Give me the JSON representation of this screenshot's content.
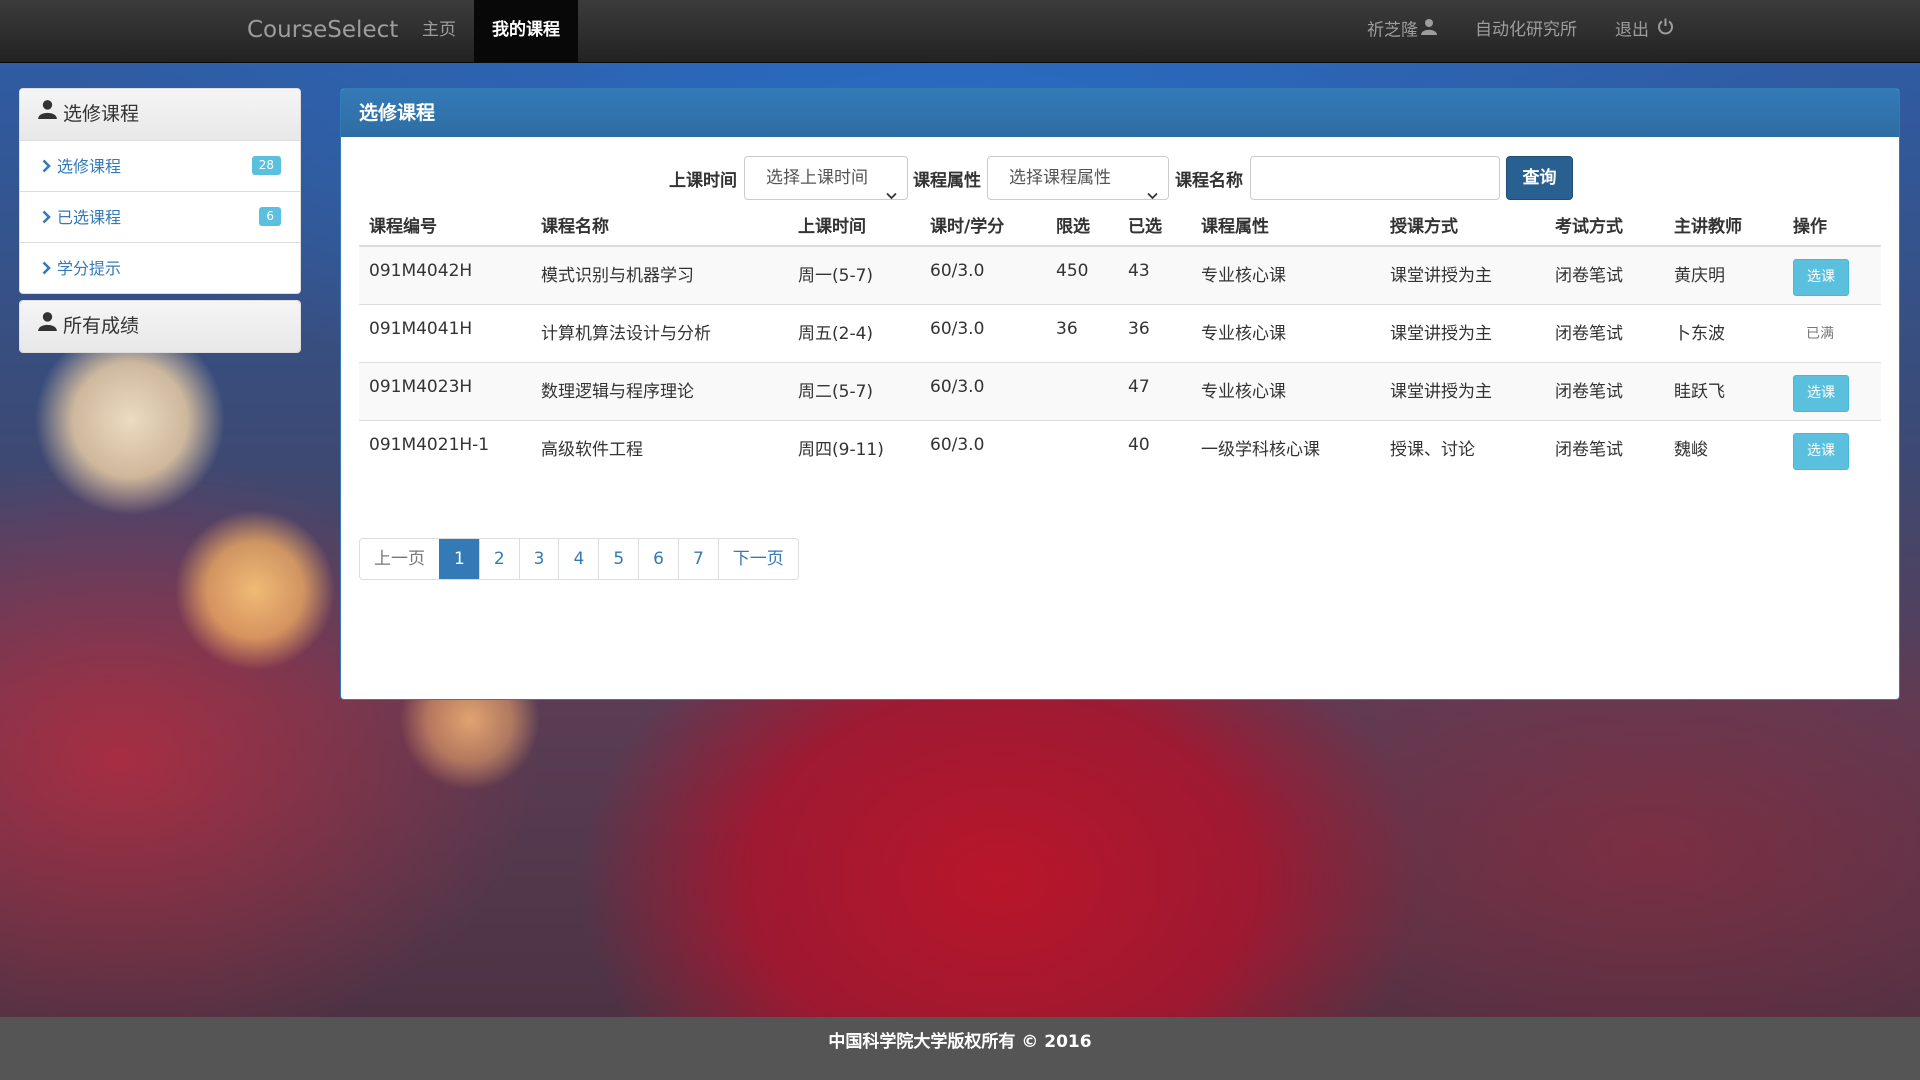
{
  "navbar": {
    "brand": "CourseSelect",
    "home": "主页",
    "my_courses": "我的课程",
    "user_name": "祈芝隆",
    "institute": "自动化研究所",
    "logout": "退出"
  },
  "sidebar": {
    "section1_title": "选修课程",
    "items": [
      {
        "label": "选修课程",
        "badge": "28"
      },
      {
        "label": "已选课程",
        "badge": "6"
      },
      {
        "label": "学分提示",
        "badge": ""
      }
    ],
    "section2_title": "所有成绩"
  },
  "panel": {
    "title": "选修课程",
    "filters": {
      "time_label": "上课时间",
      "time_select": "选择上课时间",
      "attr_label": "课程属性",
      "attr_select": "选择课程属性",
      "name_label": "课程名称",
      "name_value": "",
      "query_button": "查询"
    },
    "table": {
      "headers": [
        "课程编号",
        "课程名称",
        "上课时间",
        "课时/学分",
        "限选",
        "已选",
        "课程属性",
        "授课方式",
        "考试方式",
        "主讲教师",
        "操作"
      ],
      "rows": [
        {
          "code": "091M4042H",
          "name": "模式识别与机器学习",
          "time": "周一(5-7)",
          "hours": "60/3.0",
          "limit": "450",
          "selected": "43",
          "attr": "专业核心课",
          "mode": "课堂讲授为主",
          "exam": "闭卷笔试",
          "teacher": "黄庆明",
          "action": "选课",
          "full": false
        },
        {
          "code": "091M4041H",
          "name": "计算机算法设计与分析",
          "time": "周五(2-4)",
          "hours": "60/3.0",
          "limit": "36",
          "selected": "36",
          "attr": "专业核心课",
          "mode": "课堂讲授为主",
          "exam": "闭卷笔试",
          "teacher": "卜东波",
          "action": "已满",
          "full": true
        },
        {
          "code": "091M4023H",
          "name": "数理逻辑与程序理论",
          "time": "周二(5-7)",
          "hours": "60/3.0",
          "limit": "",
          "selected": "47",
          "attr": "专业核心课",
          "mode": "课堂讲授为主",
          "exam": "闭卷笔试",
          "teacher": "眭跃飞",
          "action": "选课",
          "full": false
        },
        {
          "code": "091M4021H-1",
          "name": "高级软件工程",
          "time": "周四(9-11)",
          "hours": "60/3.0",
          "limit": "",
          "selected": "40",
          "attr": "一级学科核心课",
          "mode": "授课、讨论",
          "exam": "闭卷笔试",
          "teacher": "魏峻",
          "action": "选课",
          "full": false
        }
      ]
    },
    "pagination": {
      "prev": "上一页",
      "pages": [
        "1",
        "2",
        "3",
        "4",
        "5",
        "6",
        "7"
      ],
      "current": "1",
      "next": "下一页"
    }
  },
  "footer": {
    "copyright": "中国科学院大学版权所有 © 2016"
  },
  "colors": {
    "primary": "#337ab7",
    "info": "#5bc0de",
    "navbar": "#222222",
    "footer": "#555555"
  },
  "icons": [
    "user-icon",
    "chevron-right-icon",
    "power-icon",
    "caret-down-icon"
  ]
}
